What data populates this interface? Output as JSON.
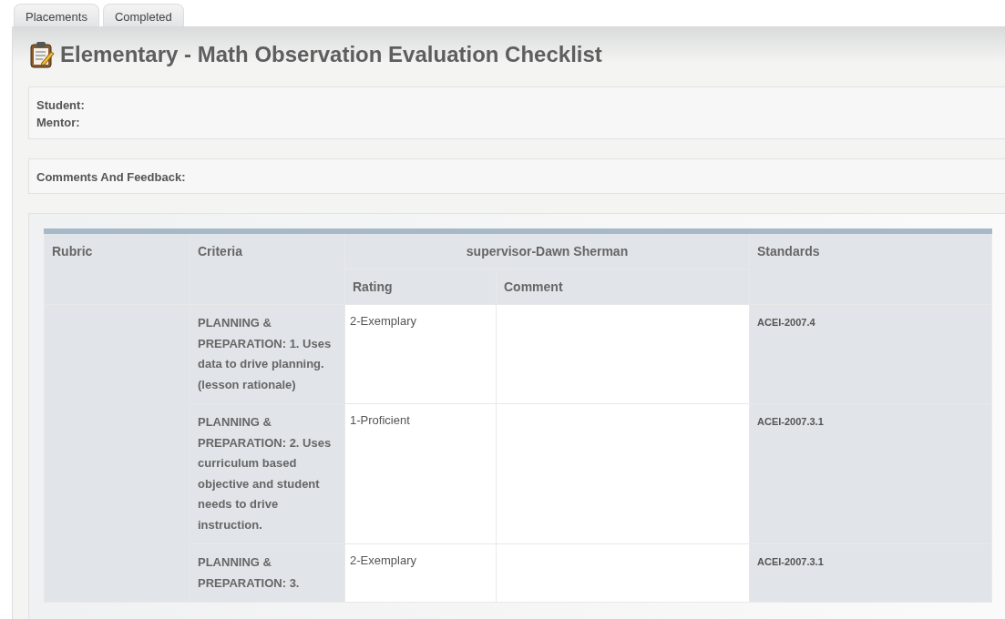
{
  "tabs": [
    {
      "label": "Placements",
      "selected": false
    },
    {
      "label": "Completed",
      "selected": false
    }
  ],
  "title": "Elementary - Math Observation Evaluation Checklist",
  "info_fields": [
    "Student:",
    "Mentor:"
  ],
  "comments_label": "Comments And Feedback:",
  "table": {
    "columns": {
      "rubric": "Rubric",
      "criteria": "Criteria",
      "evaluator": "supervisor-Dawn Sherman",
      "rating": "Rating",
      "comment": "Comment",
      "standards": "Standards"
    },
    "rows": [
      {
        "criteria": "PLANNING & PREPARATION: 1. Uses data to drive planning.(lesson rationale)",
        "rating": "2-Exemplary",
        "standards": "ACEI-2007.4"
      },
      {
        "criteria": "PLANNING & PREPARATION: 2. Uses curriculum based objective and student needs to drive instruction.",
        "rating": "1-Proficient",
        "standards": "ACEI-2007.3.1"
      },
      {
        "criteria": "PLANNING & PREPARATION: 3.",
        "rating": "2-Exemplary",
        "standards": "ACEI-2007.3.1"
      }
    ]
  }
}
